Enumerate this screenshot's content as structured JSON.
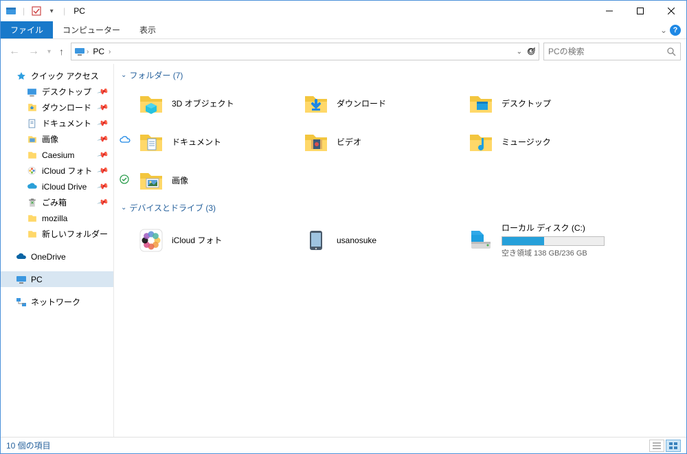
{
  "titlebar": {
    "title": "PC"
  },
  "ribbon": {
    "file": "ファイル",
    "tabs": [
      "コンピューター",
      "表示"
    ]
  },
  "address": {
    "crumbs": [
      "PC"
    ],
    "search_placeholder": "PCの検索"
  },
  "sidebar": {
    "quick_access": {
      "label": "クイック アクセス"
    },
    "quick_items": [
      {
        "label": "デスクトップ",
        "pinned": true,
        "icon": "desktop"
      },
      {
        "label": "ダウンロード",
        "pinned": true,
        "icon": "downloads"
      },
      {
        "label": "ドキュメント",
        "pinned": true,
        "icon": "documents"
      },
      {
        "label": "画像",
        "pinned": true,
        "icon": "pictures"
      },
      {
        "label": "Caesium",
        "pinned": true,
        "icon": "folder"
      },
      {
        "label": "iCloud フォト",
        "pinned": true,
        "icon": "icloud-photos"
      },
      {
        "label": "iCloud Drive",
        "pinned": true,
        "icon": "icloud"
      },
      {
        "label": "ごみ箱",
        "pinned": true,
        "icon": "recycle"
      },
      {
        "label": "mozilla",
        "pinned": false,
        "icon": "folder"
      },
      {
        "label": "新しいフォルダー",
        "pinned": false,
        "icon": "folder"
      }
    ],
    "onedrive": {
      "label": "OneDrive"
    },
    "pc": {
      "label": "PC"
    },
    "network": {
      "label": "ネットワーク"
    }
  },
  "groups": {
    "folders": {
      "title": "フォルダー (7)"
    },
    "devices": {
      "title": "デバイスとドライブ (3)"
    }
  },
  "folders": [
    {
      "label": "3D オブジェクト",
      "icon": "3d"
    },
    {
      "label": "ダウンロード",
      "icon": "downloads"
    },
    {
      "label": "デスクトップ",
      "icon": "desktop"
    },
    {
      "label": "ドキュメント",
      "icon": "documents",
      "sync": "cloud"
    },
    {
      "label": "ビデオ",
      "icon": "videos"
    },
    {
      "label": "ミュージック",
      "icon": "music"
    },
    {
      "label": "画像",
      "icon": "pictures",
      "sync": "check"
    }
  ],
  "devices": [
    {
      "label": "iCloud フォト",
      "icon": "icloud-photos"
    },
    {
      "label": "usanosuke",
      "icon": "phone"
    },
    {
      "label": "ローカル ディスク (C:)",
      "icon": "drive",
      "free_text": "空き領域 138 GB/236 GB",
      "used_pct": 41.5
    }
  ],
  "statusbar": {
    "count": "10 個の項目"
  }
}
